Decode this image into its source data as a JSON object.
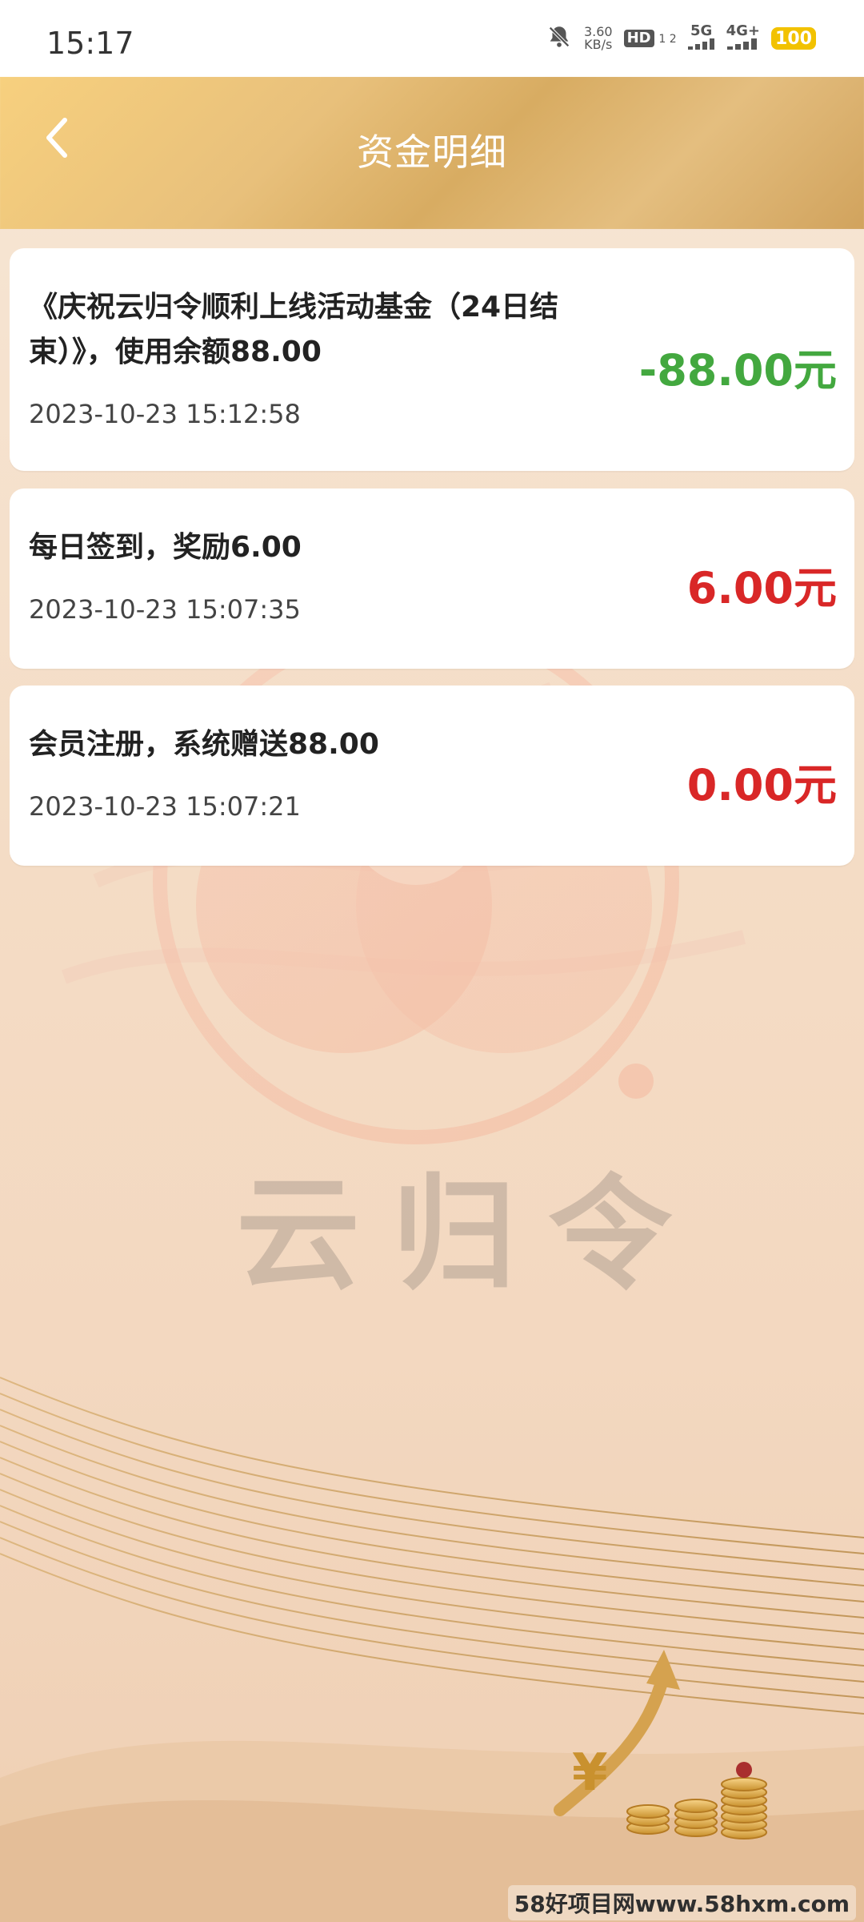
{
  "status_bar": {
    "time": "15:17",
    "net_speed_value": "3.60",
    "net_speed_unit": "KB/s",
    "hd_label": "HD",
    "sim_numbers": "1 2",
    "g5_label": "5G",
    "g4_label": "4G+",
    "battery_level": "100"
  },
  "header": {
    "title": "资金明细"
  },
  "transactions": [
    {
      "description": "《庆祝云归令顺利上线活动基金（24日结束）》，使用余额88.00",
      "timestamp": "2023-10-23 15:12:58",
      "amount": "-88.00元",
      "type": "negative"
    },
    {
      "description": "每日签到，奖励6.00",
      "timestamp": "2023-10-23 15:07:35",
      "amount": "6.00元",
      "type": "positive"
    },
    {
      "description": "会员注册，系统赠送88.00",
      "timestamp": "2023-10-23 15:07:21",
      "amount": "0.00元",
      "type": "positive"
    }
  ],
  "background": {
    "brand_text": "云归令"
  },
  "footer": {
    "watermark": "58好项目网www.58hxm.com"
  },
  "colors": {
    "negative": "#43a83f",
    "positive": "#d92727",
    "header_gold": "#e0b86f"
  },
  "icons": {
    "back": "chevron-left-icon",
    "mute": "bell-muted-icon"
  }
}
